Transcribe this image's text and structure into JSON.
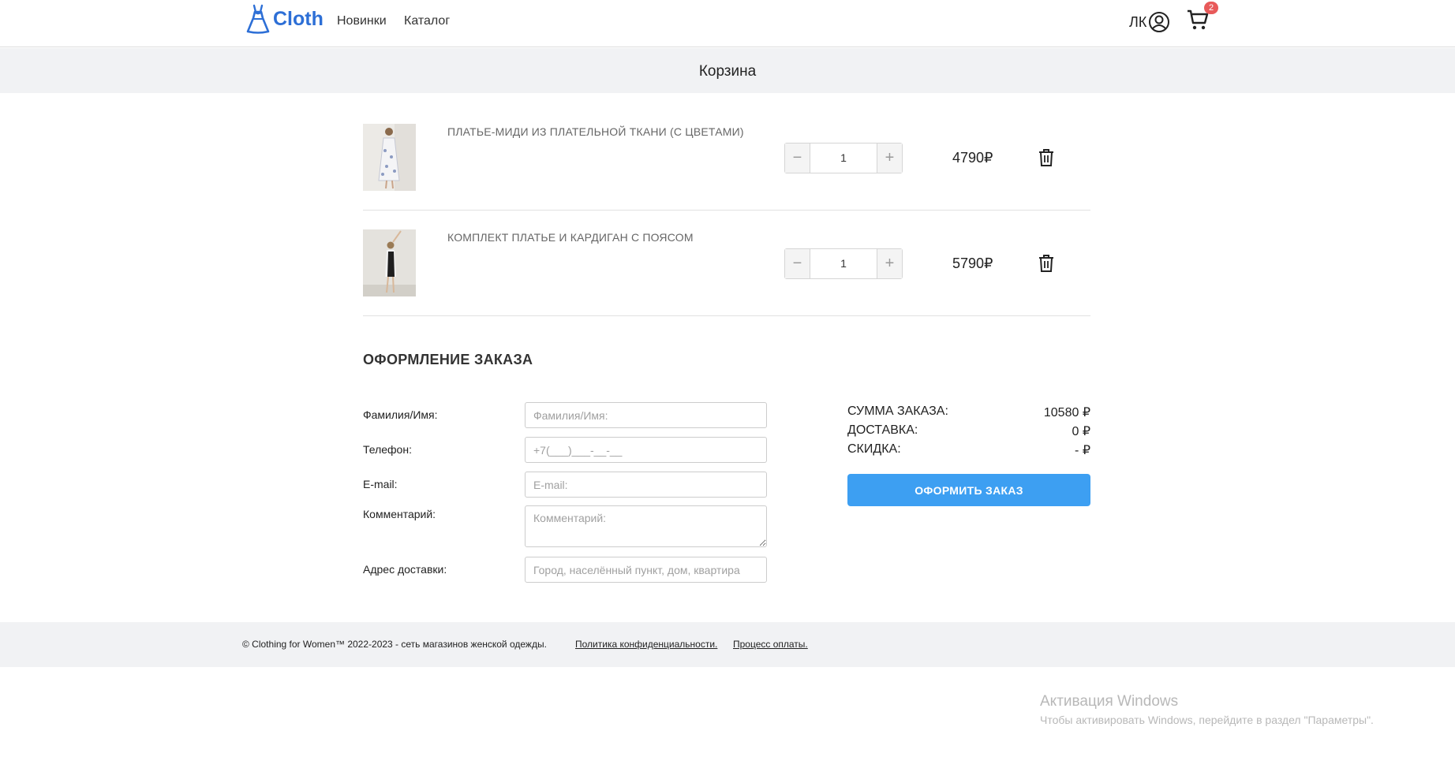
{
  "header": {
    "logo_text": "Cloth",
    "nav": {
      "new": "Новинки",
      "catalog": "Каталог"
    },
    "account_label": "ЛК",
    "cart_count": "2"
  },
  "page": {
    "title": "Корзина"
  },
  "cart": {
    "items": [
      {
        "name": "ПЛАТЬЕ-МИДИ ИЗ ПЛАТЕЛЬНОЙ ТКАНИ (С ЦВЕТАМИ)",
        "qty": "1",
        "price": "4790₽"
      },
      {
        "name": "КОМПЛЕКТ ПЛАТЬЕ И КАРДИГАН С ПОЯСОМ",
        "qty": "1",
        "price": "5790₽"
      }
    ],
    "minus_symbol": "−",
    "plus_symbol": "+"
  },
  "order": {
    "title": "ОФОРМЛЕНИЕ ЗАКАЗА",
    "fields": {
      "name": {
        "label": "Фамилия/Имя:",
        "placeholder": "Фамилия/Имя:"
      },
      "phone": {
        "label": "Телефон:",
        "placeholder": "+7(___)___-__-__"
      },
      "email": {
        "label": "E-mail:",
        "placeholder": "E-mail:"
      },
      "comment": {
        "label": "Комментарий:",
        "placeholder": "Комментарий:"
      },
      "address": {
        "label": "Адрес доставки:",
        "placeholder": "Город, населённый пункт, дом, квартира"
      }
    },
    "summary": {
      "total_label": "СУММА ЗАКАЗА:",
      "total_value": "10580 ₽",
      "delivery_label": "ДОСТАВКА:",
      "delivery_value": "0 ₽",
      "discount_label": "СКИДКА:",
      "discount_value": "- ₽"
    },
    "submit_label": "ОФОРМИТЬ ЗАКАЗ"
  },
  "footer": {
    "copyright": "© Clothing for Women™ 2022-2023 - сеть магазинов женской одежды.",
    "privacy": "Политика конфиденциальности.",
    "payment": "Процесс оплаты."
  },
  "watermark": {
    "title": "Активация Windows",
    "subtitle": "Чтобы активировать Windows, перейдите в раздел \"Параметры\"."
  },
  "colors": {
    "brand": "#2d6fd6",
    "button": "#3d9ff2",
    "badge": "#e85a5a",
    "band": "#f1f2f4"
  },
  "icons": [
    "dress-icon",
    "user-circle-icon",
    "cart-icon",
    "trash-icon"
  ]
}
